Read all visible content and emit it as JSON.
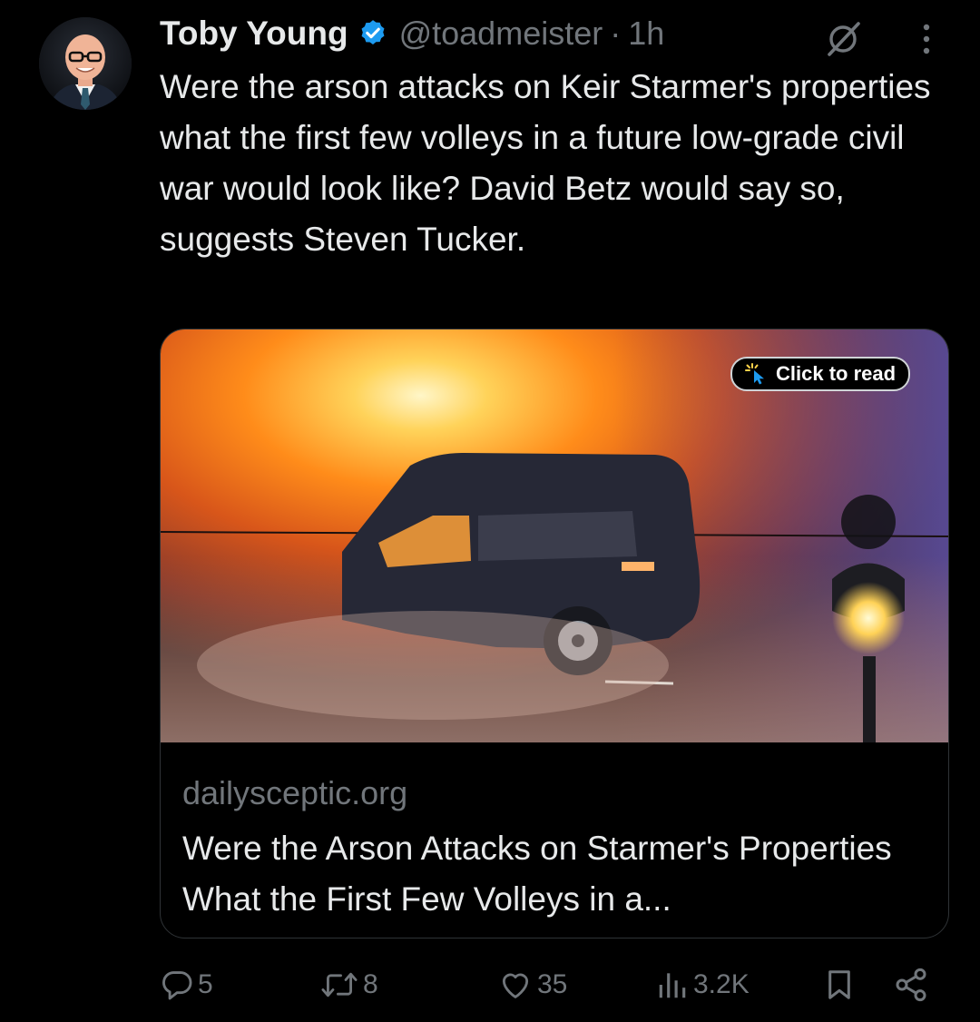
{
  "author": {
    "display_name": "Toby Young",
    "handle": "@toadmeister",
    "separator": "·",
    "time": "1h",
    "verified": true
  },
  "tweet": {
    "text": "Were the arson attacks on Keir Starmer's properties what the first few volleys in a future low-grade civil war would look like? David Betz would say so, suggests Steven Tucker."
  },
  "card": {
    "badge_label": "Click to read",
    "domain": "dailysceptic.org",
    "title": "Were the Arson Attacks on Starmer's Properties What the First Few Volleys in a..."
  },
  "actions": {
    "replies": "5",
    "reposts": "8",
    "likes": "35",
    "views": "3.2K"
  },
  "icons": {
    "verified": "verified-badge-icon",
    "grok": "grok-icon",
    "more": "more-vertical-icon",
    "reply": "reply-icon",
    "repost": "repost-icon",
    "like": "heart-icon",
    "views": "views-icon",
    "bookmark": "bookmark-icon",
    "share": "share-icon"
  },
  "colors": {
    "background": "#000000",
    "text_primary": "#e7e9ea",
    "text_secondary": "#71767b",
    "verified_blue": "#1d9bf0",
    "card_border": "#2f3336"
  }
}
